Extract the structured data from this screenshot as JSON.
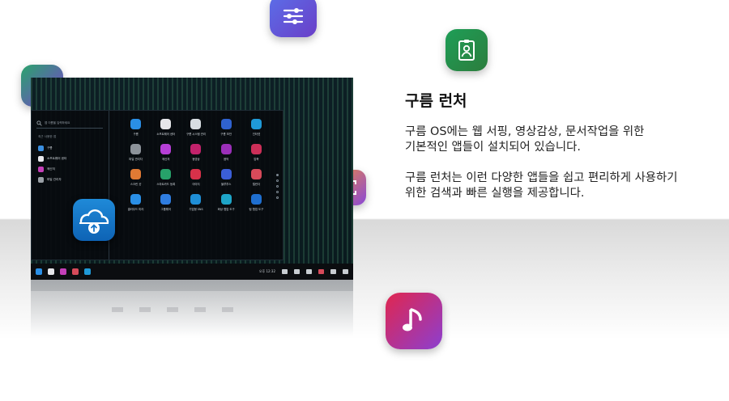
{
  "feature": {
    "title": "구름 런처",
    "para1": [
      "구름 OS에는 웹 서핑, 영상감상, 문서작업을 위한",
      "기본적인 앱들이 설치되어 있습니다."
    ],
    "para2": [
      "구름 런처는 이런 다양한 앱들을 쉽고 편리하게 사용하기",
      "위한 검색과 빠른 실행을 제공합니다."
    ]
  },
  "floating_icons": [
    {
      "name": "settings-sliders-icon",
      "color": "#5b6ee8"
    },
    {
      "name": "card-icon",
      "color": "#2aa36c"
    },
    {
      "name": "id-badge-icon",
      "color": "#1e9e57"
    },
    {
      "name": "camera-icon",
      "color": "#f08a3a"
    },
    {
      "name": "music-note-icon",
      "color": "#e0264f"
    }
  ],
  "launcher": {
    "search_placeholder": "앱 이름을 입력하세요",
    "recent_label": "최근 사용한 앱",
    "recent_apps": [
      {
        "label": "구름",
        "color": "#3b8fe0"
      },
      {
        "label": "소프트웨어 센터",
        "color": "#e8e8ec"
      },
      {
        "label": "메신저",
        "color": "#c43fb8"
      },
      {
        "label": "파일 관리자",
        "color": "#9aa0a6"
      }
    ],
    "apps": [
      {
        "label": "구름",
        "color": "#2a8fe6"
      },
      {
        "label": "소프트웨어 센터",
        "color": "#e6e6ea"
      },
      {
        "label": "구름 시스템 관리",
        "color": "#d8dde2"
      },
      {
        "label": "구름 보안",
        "color": "#2f62d0"
      },
      {
        "label": "인터넷",
        "color": "#1f9ad8"
      },
      {
        "label": "파일 관리자",
        "color": "#8d939a"
      },
      {
        "label": "메신저",
        "color": "#b63fd6"
      },
      {
        "label": "동영상",
        "color": "#c2226b"
      },
      {
        "label": "음악",
        "color": "#9a2fb8"
      },
      {
        "label": "압축",
        "color": "#cc2f58"
      },
      {
        "label": "스크린 샷",
        "color": "#e07a34"
      },
      {
        "label": "스마트카드 등록",
        "color": "#27a26a"
      },
      {
        "label": "이미지",
        "color": "#d8314a"
      },
      {
        "label": "블루투스",
        "color": "#3b5fd8"
      },
      {
        "label": "캘린더",
        "color": "#d64a5a"
      },
      {
        "label": "클라우드 미러",
        "color": "#2a8fe6"
      },
      {
        "label": "그룹웨어",
        "color": "#2f7de0"
      },
      {
        "label": "기업형 SNS",
        "color": "#1f8ed6"
      },
      {
        "label": "화상 협업 도구",
        "color": "#1ea5c8"
      },
      {
        "label": "팀 협업 도구",
        "color": "#1f6fd0"
      }
    ],
    "page_count": 5,
    "active_page": 0
  },
  "taskbar": {
    "clock": "오후 12:32",
    "pinned_colors": [
      "#2a8fe6",
      "#e6e6ea",
      "#c43fb8",
      "#d64a5a",
      "#1f9ad8"
    ]
  }
}
